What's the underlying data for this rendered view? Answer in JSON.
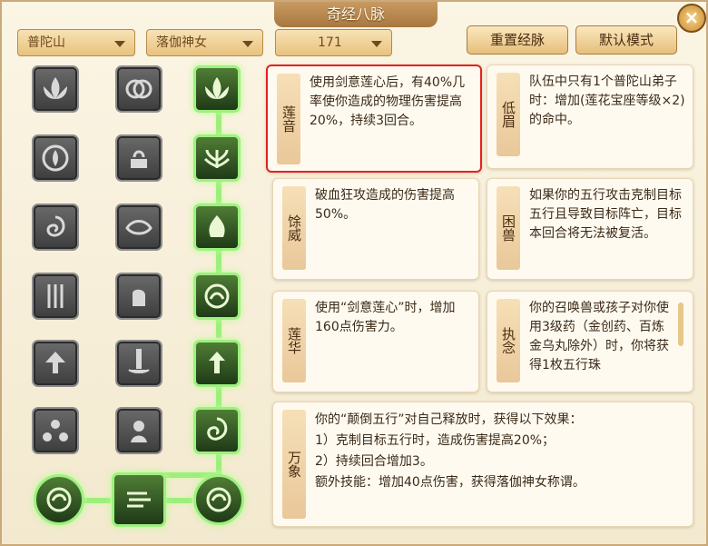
{
  "window": {
    "title": "奇经八脉",
    "close": "×"
  },
  "toolbar": {
    "sect": "普陀山",
    "role": "落伽神女",
    "level": "171",
    "reset_button": "重置经脉",
    "default_button": "默认模式"
  },
  "cards": [
    {
      "name": "莲音",
      "desc": "使用剑意莲心后，有40%几率使你造成的物理伤害提高20%，持续3回合。"
    },
    {
      "name": "低眉",
      "desc": "队伍中只有1个普陀山弟子时：增加(莲花宝座等级×2)的命中。"
    },
    {
      "name": "馀威",
      "desc": "破血狂攻造成的伤害提高50%。"
    },
    {
      "name": "困兽",
      "desc": "如果你的五行攻击克制目标五行且导致目标阵亡，目标本回合将无法被复活。"
    },
    {
      "name": "莲华",
      "desc": "使用“剑意莲心”时，增加160点伤害力。"
    },
    {
      "name": "执念",
      "desc": "你的召唤兽或孩子对你使用3级药（金创药、百炼金乌丸除外）时，你将获得1枚五行珠"
    },
    {
      "name": "万象",
      "lines": [
        "你的“颠倒五行”对自己释放时，获得以下效果：",
        "1）克制目标五行时，造成伤害提高20%；",
        "2）持续回合增加3。",
        "额外技能：增加40点伤害，获得落伽神女称谓。"
      ]
    }
  ],
  "colors": {
    "accent": "#e3221f",
    "active_green": "#9ef07f"
  }
}
